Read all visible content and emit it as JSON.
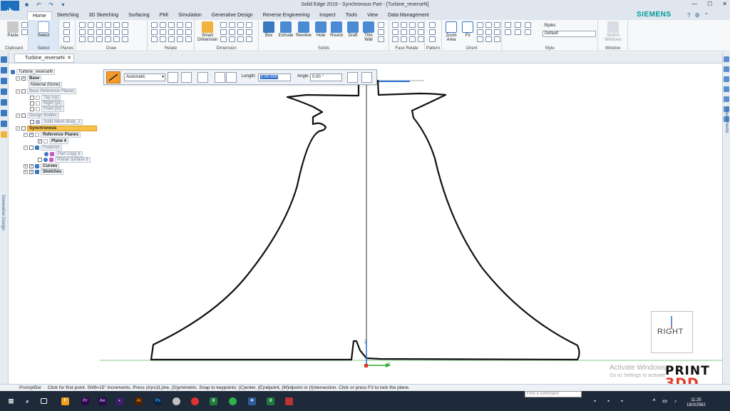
{
  "window": {
    "title": "Solid Edge 2019 - Synchronous Part - [Turbine_reverseN]",
    "brand": "SIEMENS"
  },
  "ribbon": {
    "tabs": [
      "Home",
      "Sketching",
      "3D Sketching",
      "Surfacing",
      "PMI",
      "Simulation",
      "Generative Design",
      "Reverse Engineering",
      "Inspect",
      "Tools",
      "View",
      "Data Management"
    ],
    "active_tab": "Home",
    "groups": {
      "clipboard": "Clipboard",
      "select": "Select",
      "planes": "Planes",
      "draw": "Draw",
      "relate": "Relate",
      "dimension": "Dimension",
      "solids": "Solids",
      "face_relate": "Face Relate",
      "pattern": "Pattern",
      "orient": "Orient",
      "style": "Style",
      "window": "Window"
    },
    "buttons": {
      "paste": "Paste",
      "select": "Select",
      "smart_dimension": "Smart Dimension",
      "box": "Box",
      "extrude": "Extrude",
      "revolve": "Revolve",
      "hole": "Hole",
      "round": "Round",
      "draft": "Draft",
      "thin_wall": "Thin Wall",
      "zoom_area": "Zoom Area",
      "fit": "Fit",
      "styles": "Styles",
      "switch_windows": "Switch Windows"
    },
    "style_value": "Default"
  },
  "document_tab": {
    "name": "Turbine_reverseN"
  },
  "docks": {
    "left_label": "Generative Design",
    "right_label": "Requirements"
  },
  "tree": {
    "root": "Turbine_reverseN",
    "base": "Base",
    "material": "Material (None)",
    "base_ref_planes": "Base Reference Planes",
    "top": "Top (xy)",
    "right": "Right (yz)",
    "front": "Front (xz)",
    "design_bodies": "Design Bodies",
    "solid_mesh": "Solid Mesh Body_2",
    "synchronous": "Synchronous",
    "reference_planes": "Reference Planes",
    "plane4": "Plane 4",
    "features": "Features",
    "part_copy": "Part Copy 6",
    "planar_surface": "Planar surface 8",
    "curves": "Curves",
    "sketches": "Sketches"
  },
  "command_bar": {
    "mode": "Automatic",
    "length_label": "Length:",
    "length_value": "0.00 mm",
    "angle_label": "Angle:",
    "angle_value": "0.00 °"
  },
  "canvas": {
    "view_label": "RIGHT",
    "axis_z": "Z",
    "axis_y": "Y",
    "watermark_title": "Activate Windows",
    "watermark_sub": "Go to Settings to activate",
    "logo_top": "PRINT",
    "logo_bottom": "3DD"
  },
  "prompt": {
    "label": "PromptBar",
    "text": "Click for first point.  Shift=15° increments. Press (A)rc/(L)ine, (S)ymmetric. Snap to keypoints: (C)enter, (E)ndpoint, (M)idpoint or (I)ntersection.  Click or press F3 to lock the plane."
  },
  "taskbar": {
    "search_placeholder": "Find a command",
    "time": "11:25",
    "date": "18/3/2562"
  },
  "colors": {
    "accent": "#1e6fbf",
    "highlight": "#f6c24a",
    "sketch_line": "#111111",
    "green_axis": "#3fae3f"
  }
}
